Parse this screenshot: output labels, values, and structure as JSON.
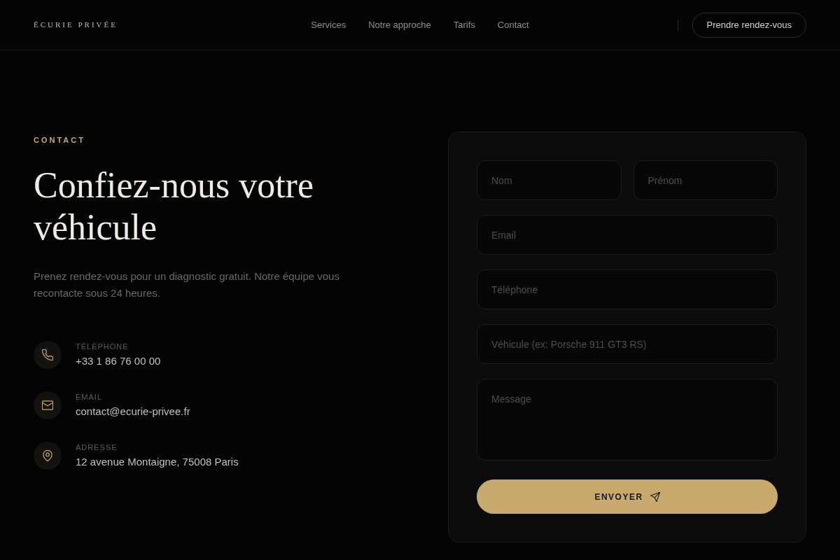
{
  "navbar": {
    "brand": "ÉCURIE PRIVÉE",
    "links": [
      {
        "label": "Services"
      },
      {
        "label": "Notre approche"
      },
      {
        "label": "Tarifs"
      },
      {
        "label": "Contact"
      }
    ],
    "cta": "Prendre rendez-vous"
  },
  "contact_section": {
    "eyebrow": "CONTACT",
    "heading": "Confiez-nous votre véhicule",
    "intro": "Prenez rendez-vous pour un diagnostic gratuit. Notre équipe vous recontacte sous 24 heures.",
    "details": [
      {
        "kind": "phone",
        "label": "TÉLÉPHONE",
        "value": "+33 1 86 76 00 00"
      },
      {
        "kind": "email",
        "label": "EMAIL",
        "value": "contact@ecurie-privee.fr"
      },
      {
        "kind": "address",
        "label": "ADRESSE",
        "value": "12 avenue Montaigne, 75008 Paris"
      }
    ]
  },
  "form": {
    "rows": [
      {
        "fields": [
          {
            "kind": "input",
            "placeholder": "Nom"
          },
          {
            "kind": "input",
            "placeholder": "Prénom"
          }
        ]
      },
      {
        "fields": [
          {
            "kind": "input",
            "placeholder": "Email"
          }
        ]
      },
      {
        "fields": [
          {
            "kind": "input",
            "placeholder": "Téléphone"
          }
        ]
      },
      {
        "fields": [
          {
            "kind": "input",
            "placeholder": "Véhicule (ex: Porsche 911 GT3 RS)"
          }
        ]
      },
      {
        "fields": [
          {
            "kind": "textarea",
            "placeholder": "Message"
          }
        ]
      }
    ],
    "submit": "ENVOYER"
  }
}
